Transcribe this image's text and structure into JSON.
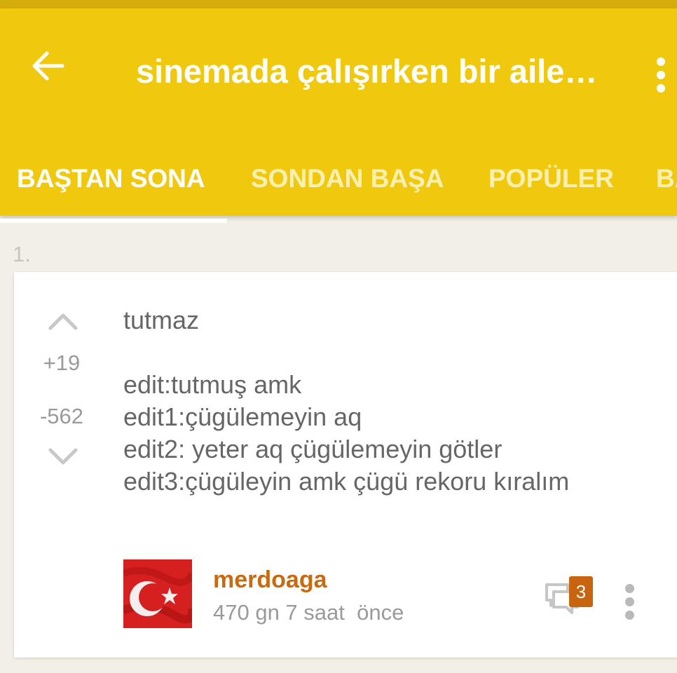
{
  "header": {
    "back_icon": "arrow-left-icon",
    "title": "sinemada çalışırken bir aile…",
    "more_icon": "more-vertical-icon",
    "bg_color": "#f0c90f"
  },
  "tabs": [
    {
      "label": "BAŞTAN SONA",
      "active": true
    },
    {
      "label": "SONDAN BAŞA",
      "active": false
    },
    {
      "label": "POPÜLER",
      "active": false
    },
    {
      "label": "BA",
      "active": false
    }
  ],
  "entry": {
    "number": "1.",
    "upvotes": "+19",
    "downvotes": "-562",
    "lines": [
      "tutmaz",
      "",
      "edit:tutmuş amk",
      "edit1:çügülemeyin aq",
      "edit2: yeter aq çügülemeyin götler",
      "edit3:çügüleyin amk çügü rekoru kıralım"
    ],
    "author": "merdoaga",
    "timestamp": "470 gn 7 saat  önce",
    "comment_count": "3",
    "author_color": "#c86a10",
    "badge_color": "#c8630e"
  }
}
